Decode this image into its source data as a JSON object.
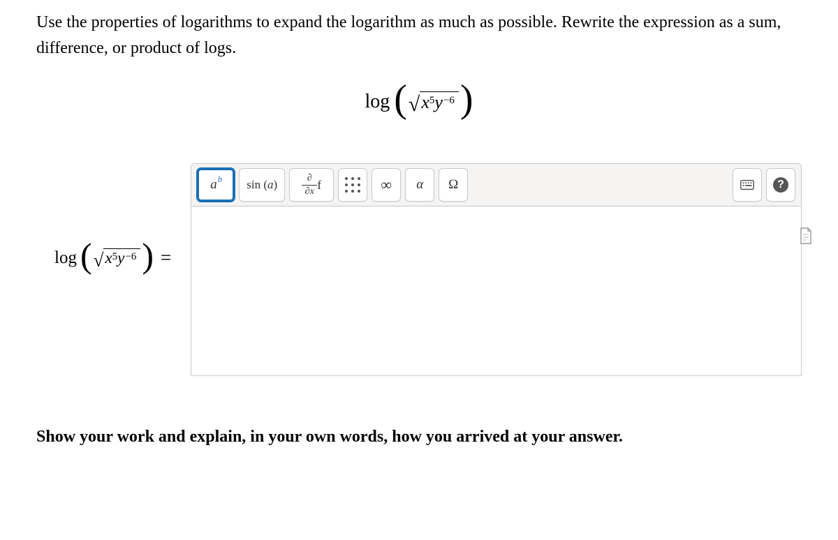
{
  "prompt": "Use the properties of logarithms to expand the logarithm as much as possible. Rewrite the expression as a sum, difference, or product of logs.",
  "expression": {
    "func": "log",
    "base_var": "x",
    "exp1": "5",
    "var2": "y",
    "exp2": "−6"
  },
  "toolbar": {
    "exponent_a": "a",
    "exponent_b": "b",
    "trig": "sin",
    "trig_arg": "a",
    "alpha": "α",
    "omega": "Ω",
    "infinity": "∞",
    "help": "?"
  },
  "equals": "=",
  "show_work": "Show your work and explain, in your own words, how you arrived at your answer."
}
